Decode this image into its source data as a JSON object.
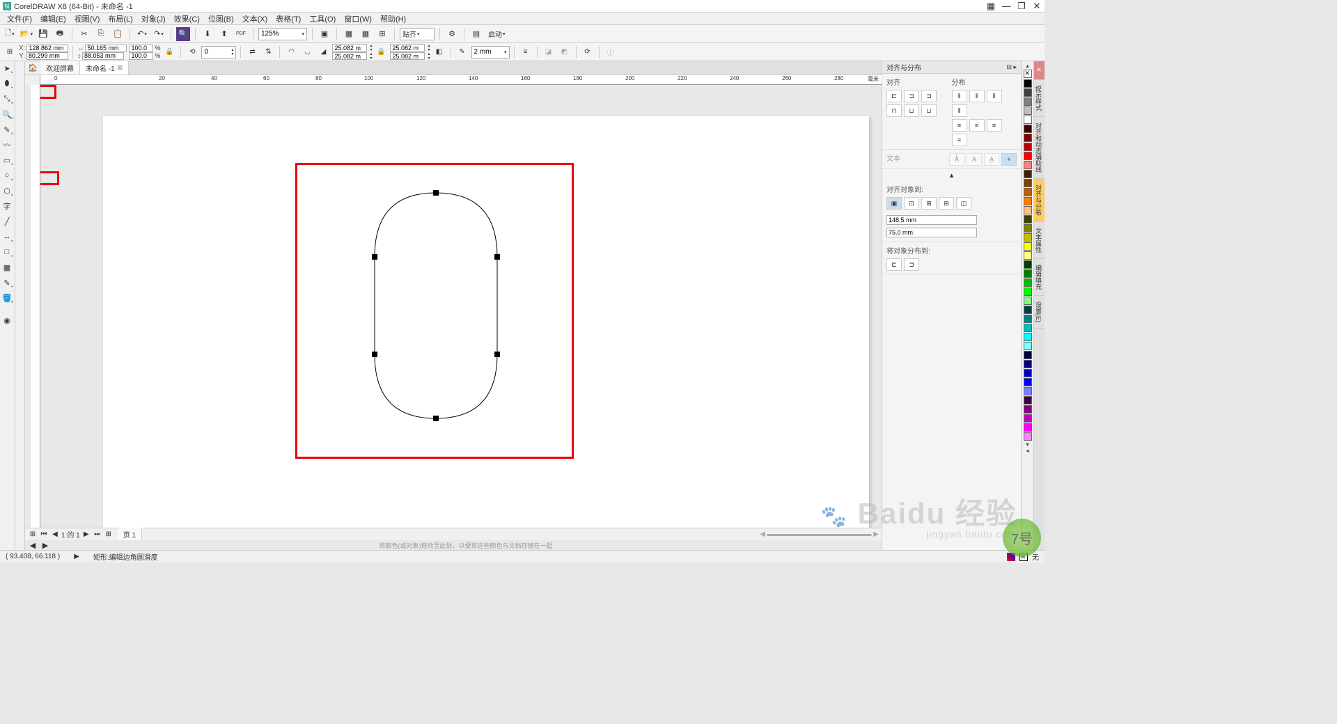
{
  "app": {
    "title": "CorelDRAW X8 (64-Bit) - 未命名 -1",
    "doc_name": "未命名 -1"
  },
  "menu": [
    "文件(F)",
    "编辑(E)",
    "视图(V)",
    "布局(L)",
    "对象(J)",
    "效果(C)",
    "位图(B)",
    "文本(X)",
    "表格(T)",
    "工具(O)",
    "窗口(W)",
    "帮助(H)"
  ],
  "toolbar1": {
    "zoom": "125%",
    "snap": "贴齐",
    "launch": "启动"
  },
  "propbar": {
    "xy_label": "X:",
    "y_label": "Y:",
    "x": "128.862 mm",
    "y": "80.299 mm",
    "w": "50.165 mm",
    "h": "88.053 mm",
    "scale_x": "100.0",
    "scale_y": "100.0",
    "pct": "%",
    "rotate": "0",
    "corner1": "25.082 m",
    "corner2": "25.082 m",
    "corner3": "25.082 m",
    "corner4": "25.082 m",
    "outline": "2 mm"
  },
  "tabs": {
    "welcome": "欢迎屏幕",
    "doc": "未命名 -1"
  },
  "ruler": {
    "unit_label": "毫米"
  },
  "align_panel": {
    "title": "对齐与分布",
    "align_label": "对齐",
    "distribute_label": "分布",
    "text_label": "文本",
    "align_to_label": "对齐对象到:",
    "margin_h": "148.5 mm",
    "margin_v": "75.0 mm",
    "distribute_to_label": "将对象分布到:"
  },
  "side_tabs": [
    "提示样式",
    "对齐和动态辅助线",
    "对齐与分布",
    "文本属性",
    "编辑填充",
    "设置(E)"
  ],
  "page_nav": {
    "pages": "1 的 1",
    "page_btn": "页 1"
  },
  "status": {
    "cursor": "( 93.408, 66.118 )",
    "tool_hint": "矩形:编辑边角圆滑度",
    "drag_hint": "将颜色(或对象)拖动至此处，以便将这些颜色与文档存储在一起",
    "fill_none": "无"
  },
  "colors": [
    "#000000",
    "#404040",
    "#808080",
    "#c0c0c0",
    "#ffffff",
    "#400000",
    "#800000",
    "#c00000",
    "#ff0000",
    "#ff8080",
    "#402000",
    "#804000",
    "#c06000",
    "#ff8000",
    "#ffc080",
    "#404000",
    "#808000",
    "#c0c000",
    "#ffff00",
    "#ffff80",
    "#004000",
    "#008000",
    "#00c000",
    "#00ff00",
    "#80ff80",
    "#004040",
    "#008080",
    "#00c0c0",
    "#00ffff",
    "#80ffff",
    "#000040",
    "#000080",
    "#0000c0",
    "#0000ff",
    "#8080ff",
    "#400040",
    "#800080",
    "#c000c0",
    "#ff00ff",
    "#ff80ff"
  ],
  "watermark": {
    "main": "Baidu 经验",
    "sub": "jingyan.baidu.com"
  }
}
